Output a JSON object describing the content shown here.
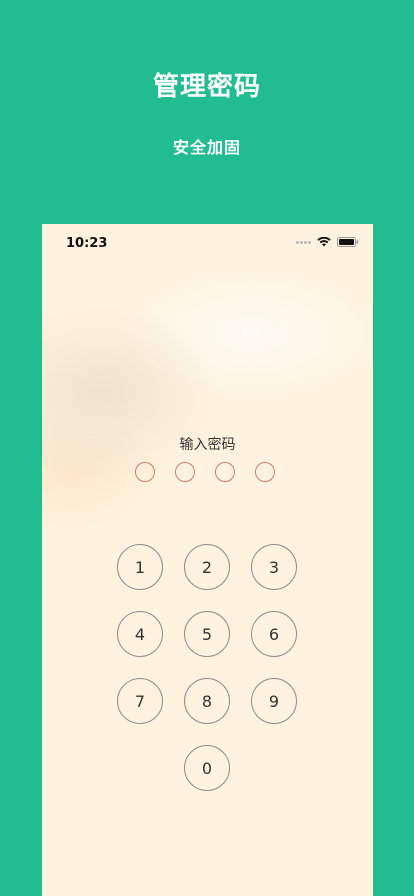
{
  "promo": {
    "title": "管理密码",
    "subtitle": "安全加固"
  },
  "status_bar": {
    "time": "10:23",
    "icons": [
      "signal-icon",
      "wifi-icon",
      "battery-icon"
    ]
  },
  "lock_screen": {
    "prompt": "输入密码",
    "pin_length": 4,
    "pin_dot_color": "#d07b66",
    "keys": [
      "1",
      "2",
      "3",
      "4",
      "5",
      "6",
      "7",
      "8",
      "9",
      "0"
    ]
  },
  "colors": {
    "background": "#21bc90",
    "screen": "#fff3df",
    "key_border": "#8d8d8d"
  }
}
